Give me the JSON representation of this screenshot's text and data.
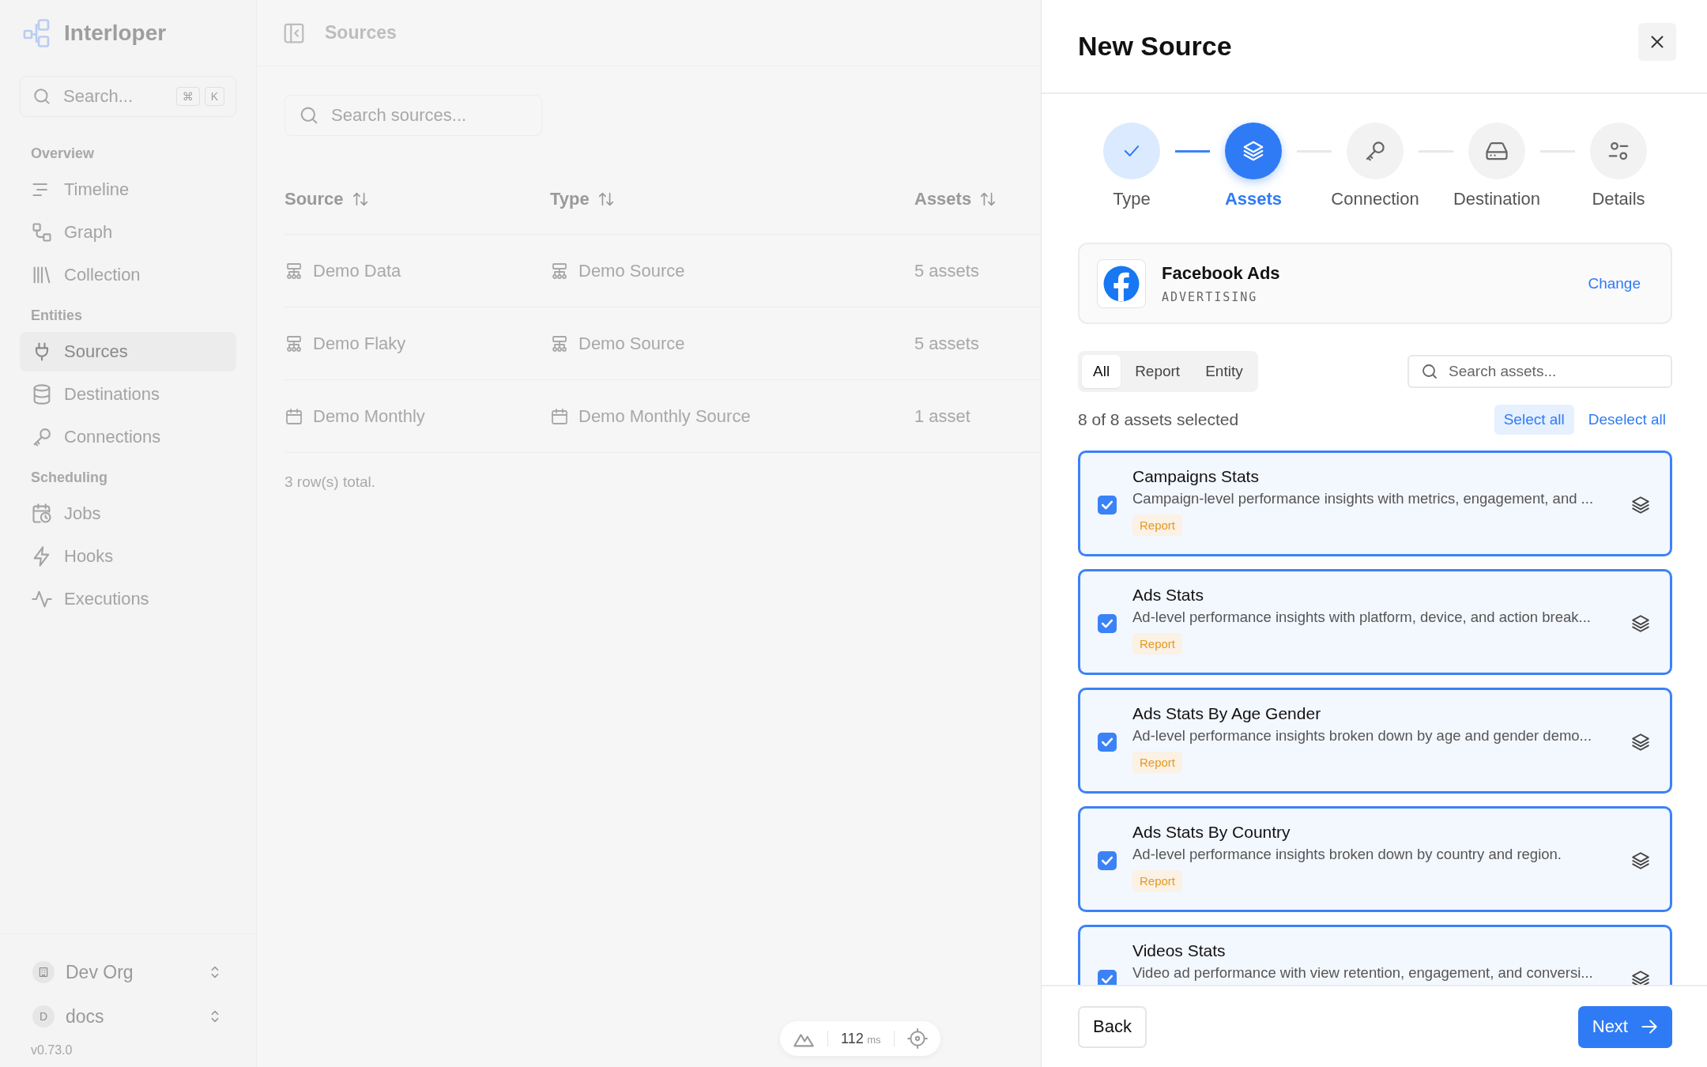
{
  "sidebar": {
    "app_name": "Interloper",
    "search": {
      "placeholder": "Search...",
      "shortcut": [
        "⌘",
        "K"
      ]
    },
    "groups": [
      {
        "label": "Overview",
        "items": [
          {
            "label": "Timeline",
            "selected": false
          },
          {
            "label": "Graph",
            "selected": false
          },
          {
            "label": "Collection",
            "selected": false
          }
        ]
      },
      {
        "label": "Entities",
        "items": [
          {
            "label": "Sources",
            "selected": true
          },
          {
            "label": "Destinations",
            "selected": false
          },
          {
            "label": "Connections",
            "selected": false
          }
        ]
      },
      {
        "label": "Scheduling",
        "items": [
          {
            "label": "Jobs",
            "selected": false
          },
          {
            "label": "Hooks",
            "selected": false
          },
          {
            "label": "Executions",
            "selected": false
          }
        ]
      }
    ],
    "switchers": [
      {
        "label": "Dev Org"
      },
      {
        "label": "docs",
        "badge": "D"
      }
    ],
    "version": "v0.73.0"
  },
  "main": {
    "title": "Sources",
    "search": {
      "placeholder": "Search sources..."
    },
    "table": {
      "columns": [
        "Source",
        "Type",
        "Assets"
      ],
      "rows": [
        {
          "source": "Demo Data",
          "type": "Demo Source",
          "assets": "5 assets"
        },
        {
          "source": "Demo Flaky",
          "type": "Demo Source",
          "assets": "5 assets"
        },
        {
          "source": "Demo Monthly",
          "type": "Demo Monthly Source",
          "assets": "1 asset"
        }
      ],
      "footer": "3 row(s) total."
    },
    "timing": {
      "value": "112",
      "unit": "ms"
    }
  },
  "drawer": {
    "title": "New Source",
    "steps": [
      {
        "label": "Type",
        "completed": true,
        "selected": false
      },
      {
        "label": "Assets",
        "completed": false,
        "selected": true
      },
      {
        "label": "Connection",
        "completed": false,
        "selected": false
      },
      {
        "label": "Destination",
        "completed": false,
        "selected": false
      },
      {
        "label": "Details",
        "completed": false,
        "selected": false
      }
    ],
    "source": {
      "name": "Facebook Ads",
      "category": "ADVERTISING",
      "action": "Change"
    },
    "filters": [
      {
        "label": "All",
        "selected": true
      },
      {
        "label": "Report",
        "selected": false
      },
      {
        "label": "Entity",
        "selected": false
      }
    ],
    "asset_search": {
      "placeholder": "Search assets..."
    },
    "selection_summary": "8 of 8 assets selected",
    "select_all": "Select all",
    "deselect_all": "Deselect all",
    "assets": [
      {
        "name": "Campaigns Stats",
        "description": "Campaign-level performance insights with metrics, engagement, and ...",
        "tag": "Report",
        "checked": true
      },
      {
        "name": "Ads Stats",
        "description": "Ad-level performance insights with platform, device, and action break...",
        "tag": "Report",
        "checked": true
      },
      {
        "name": "Ads Stats By Age Gender",
        "description": "Ad-level performance insights broken down by age and gender demo...",
        "tag": "Report",
        "checked": true
      },
      {
        "name": "Ads Stats By Country",
        "description": "Ad-level performance insights broken down by country and region.",
        "tag": "Report",
        "checked": true
      },
      {
        "name": "Videos Stats",
        "description": "Video ad performance with view retention, engagement, and conversi...",
        "checked": true
      }
    ],
    "back": "Back",
    "next": "Next"
  }
}
